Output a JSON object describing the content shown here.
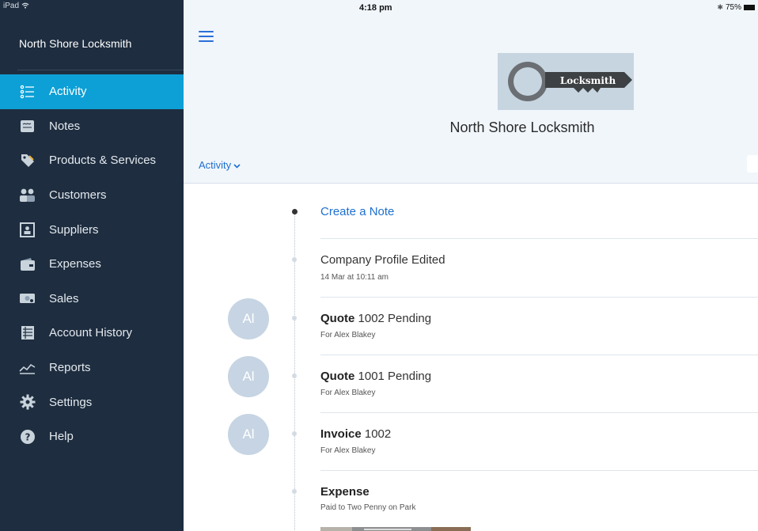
{
  "status_bar": {
    "device": "iPad",
    "time": "4:18 pm",
    "battery": "75%"
  },
  "sidebar": {
    "brand": "North Shore Locksmith",
    "items": [
      {
        "label": "Activity",
        "icon": "list-icon",
        "active": true
      },
      {
        "label": "Notes",
        "icon": "notes-icon"
      },
      {
        "label": "Products & Services",
        "icon": "tag-icon"
      },
      {
        "label": "Customers",
        "icon": "people-icon"
      },
      {
        "label": "Suppliers",
        "icon": "supplier-icon"
      },
      {
        "label": "Expenses",
        "icon": "wallet-icon"
      },
      {
        "label": "Sales",
        "icon": "sales-icon"
      },
      {
        "label": "Account History",
        "icon": "ledger-icon"
      },
      {
        "label": "Reports",
        "icon": "chart-icon"
      },
      {
        "label": "Settings",
        "icon": "gear-icon"
      },
      {
        "label": "Help",
        "icon": "help-icon"
      }
    ]
  },
  "header": {
    "logo_text": "Locksmith",
    "company_name": "North Shore Locksmith",
    "filter_label": "Activity"
  },
  "feed": {
    "create_note": "Create a Note",
    "items": [
      {
        "title": "Company Profile Edited",
        "subtitle": "14 Mar at 10:11 am"
      },
      {
        "title_bold": "Quote",
        "title_rest": " 1002 Pending",
        "subtitle": "For Alex Blakey",
        "avatar": "Al"
      },
      {
        "title_bold": "Quote",
        "title_rest": " 1001 Pending",
        "subtitle": "For Alex Blakey",
        "avatar": "Al"
      },
      {
        "title_bold": "Invoice",
        "title_rest": " 1002",
        "subtitle": "For Alex Blakey",
        "avatar": "Al"
      },
      {
        "title_bold": "Expense",
        "title_rest": "",
        "subtitle": "Paid to Two Penny on Park"
      }
    ]
  }
}
